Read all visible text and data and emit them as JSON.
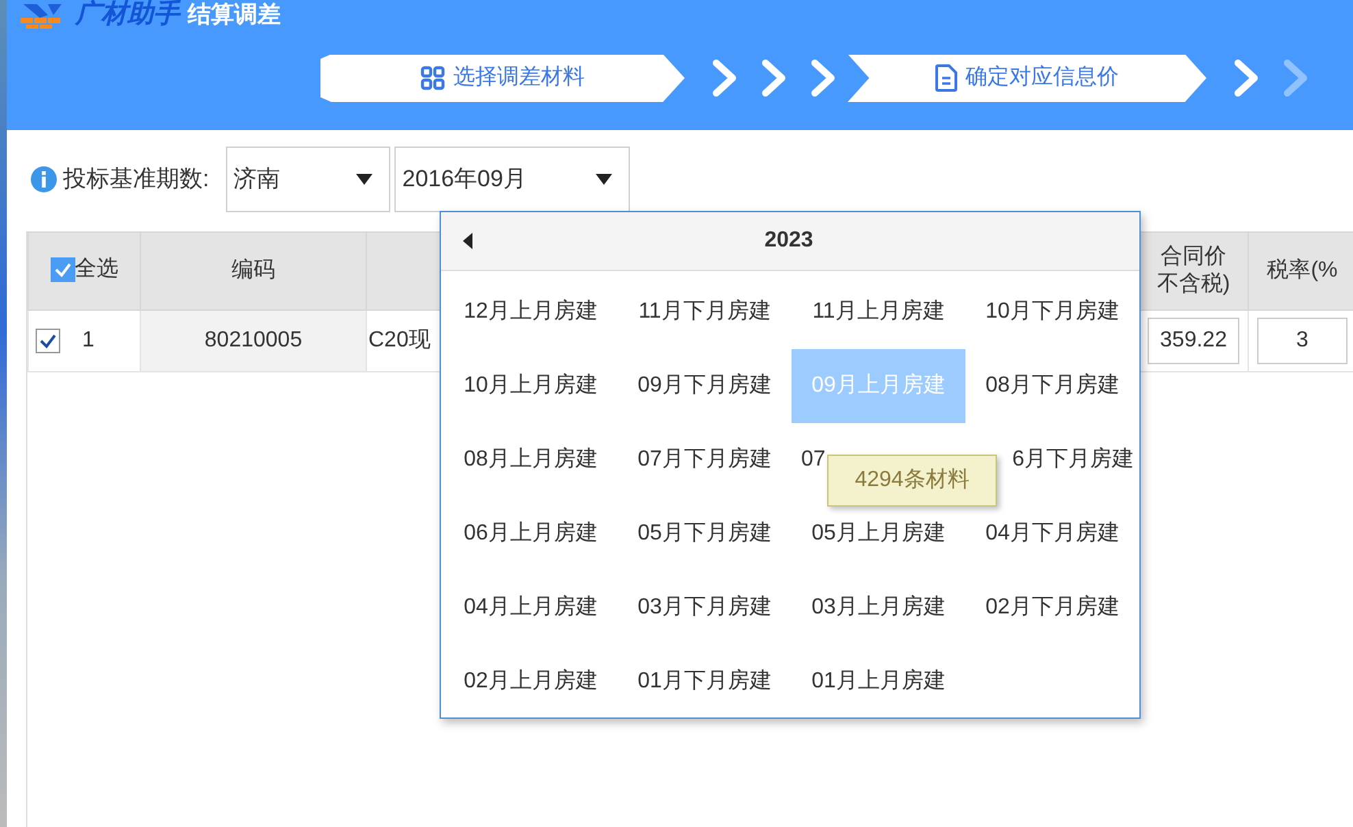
{
  "app": {
    "logo_text": "广材助手",
    "title": "结算调差"
  },
  "steps": [
    {
      "kind": "step",
      "label": "选择调差材料"
    },
    {
      "kind": "chevron",
      "dimmed": false
    },
    {
      "kind": "chevron",
      "dimmed": false
    },
    {
      "kind": "chevron",
      "dimmed": false
    },
    {
      "kind": "step",
      "label": "确定对应信息价"
    },
    {
      "kind": "chevron",
      "dimmed": false
    },
    {
      "kind": "chevron",
      "dimmed": true
    }
  ],
  "toolbar": {
    "label": "投标基准期数:",
    "region": {
      "value": "济南"
    },
    "period": {
      "value": "2016年09月"
    }
  },
  "table": {
    "columns": [
      {
        "kind": "select_all",
        "label": "全选",
        "checked": true
      },
      {
        "kind": "text",
        "label": "编码"
      },
      {
        "kind": "covered"
      },
      {
        "kind": "text",
        "lines": [
          "合同价",
          "不含税)"
        ]
      },
      {
        "kind": "text",
        "label": "税率(%"
      }
    ],
    "rows": [
      {
        "cells": [
          {
            "kind": "check",
            "checked": true,
            "text": "1"
          },
          {
            "kind": "text",
            "text": "80210005"
          },
          {
            "kind": "text",
            "text": "C20现"
          },
          {
            "kind": "input",
            "text": "359.22"
          },
          {
            "kind": "input",
            "text": "3"
          }
        ]
      }
    ]
  },
  "dropdown": {
    "year": "2023",
    "items": [
      {
        "kind": "option",
        "label": "12月上月房建",
        "selected": false
      },
      {
        "kind": "option",
        "label": "11月下月房建",
        "selected": false
      },
      {
        "kind": "option",
        "label": "11月上月房建",
        "selected": false
      },
      {
        "kind": "option",
        "label": "10月下月房建",
        "selected": false
      },
      {
        "kind": "option",
        "label": "10月上月房建",
        "selected": false
      },
      {
        "kind": "option",
        "label": "09月下月房建",
        "selected": false
      },
      {
        "kind": "option",
        "label": "09月上月房建",
        "selected": true
      },
      {
        "kind": "option",
        "label": "08月下月房建",
        "selected": false
      },
      {
        "kind": "option",
        "label": "08月上月房建",
        "selected": false
      },
      {
        "kind": "option",
        "label": "07月下月房建",
        "selected": false
      },
      {
        "kind": "cut_end",
        "label": "07",
        "selected": false
      },
      {
        "kind": "cut_start",
        "label": "6月下月房建",
        "selected": false
      },
      {
        "kind": "option",
        "label": "06月上月房建",
        "selected": false
      },
      {
        "kind": "option",
        "label": "05月下月房建",
        "selected": false
      },
      {
        "kind": "option",
        "label": "05月上月房建",
        "selected": false
      },
      {
        "kind": "option",
        "label": "04月下月房建",
        "selected": false
      },
      {
        "kind": "option",
        "label": "04月上月房建",
        "selected": false
      },
      {
        "kind": "option",
        "label": "03月下月房建",
        "selected": false
      },
      {
        "kind": "option",
        "label": "03月上月房建",
        "selected": false
      },
      {
        "kind": "option",
        "label": "02月下月房建",
        "selected": false
      },
      {
        "kind": "option",
        "label": "02月上月房建",
        "selected": false
      },
      {
        "kind": "option",
        "label": "01月下月房建",
        "selected": false
      },
      {
        "kind": "option",
        "label": "01月上月房建",
        "selected": false
      }
    ]
  },
  "tooltip": {
    "text": "4294条材料"
  }
}
